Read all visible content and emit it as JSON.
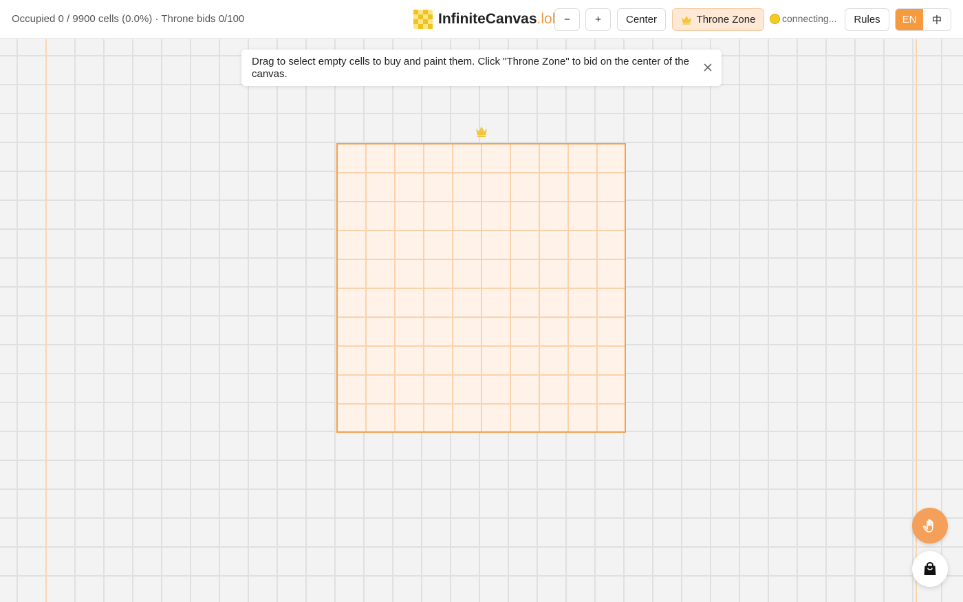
{
  "app": {
    "name": "InfiniteCanvas",
    "tld": ".lol"
  },
  "status": {
    "text": "Occupied 0 / 9900 cells (0.0%) · Throne bids 0/100"
  },
  "toolbar": {
    "zoom_out_label": "−",
    "zoom_in_label": "+",
    "center_label": "Center",
    "throne_label": "Throne Zone",
    "connection_text": "connecting...",
    "rules_label": "Rules",
    "lang_en_label": "EN",
    "lang_zh_label": "中"
  },
  "hint": {
    "text": "Drag to select empty cells to buy and paint them. Click \"Throne Zone\" to bid on the center of the canvas."
  },
  "icons": {
    "logo": "checker-logo-icon",
    "throne": "crown-icon",
    "connection": "status-dot-icon",
    "close": "close-icon",
    "hand": "hand-pointer-icon",
    "cart": "shopping-bag-icon"
  },
  "colors": {
    "accent": "#f59a3f",
    "throne_fill": "#fff3e9",
    "throne_border": "#f4a14b",
    "grid_line": "#e0e0e0",
    "connecting_dot": "#f6cb1f"
  }
}
